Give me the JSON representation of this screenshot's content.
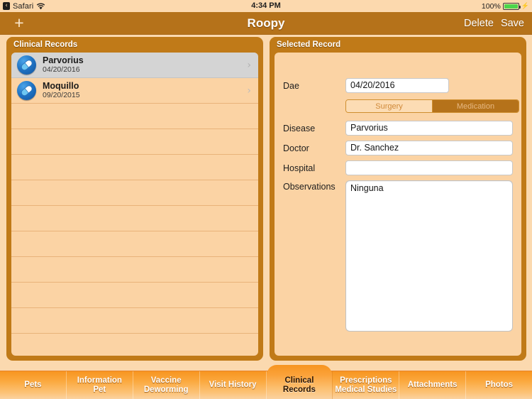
{
  "status_bar": {
    "back_glyph": "‹",
    "back_app": "Safari",
    "wifi_icon": "wifi-icon",
    "time": "4:34 PM",
    "battery_percent": "100%",
    "battery_icon": "battery-full-charging-icon"
  },
  "nav_bar": {
    "add_icon": "plus-icon",
    "add_label": "+",
    "title": "Roopy",
    "delete_label": "Delete",
    "save_label": "Save"
  },
  "left_panel": {
    "header": "Clinical Records",
    "records": [
      {
        "icon": "pill-icon",
        "title": "Parvorius",
        "date": "04/20/2016",
        "selected": true,
        "chevron": "›"
      },
      {
        "icon": "pill-icon",
        "title": "Moquillo",
        "date": "09/20/2015",
        "selected": false,
        "chevron": "›"
      }
    ],
    "empty_row_count": 10
  },
  "right_panel": {
    "header": "Selected Record",
    "fields": {
      "date_label": "Dae",
      "date_value": "04/20/2016",
      "disease_label": "Disease",
      "disease_value": "Parvorius",
      "doctor_label": "Doctor",
      "doctor_value": "Dr. Sanchez",
      "hospital_label": "Hospital",
      "hospital_value": "",
      "observations_label": "Observations",
      "observations_value": "Ninguna"
    },
    "segmented": {
      "options": [
        "Surgery",
        "Medication"
      ],
      "surgery_label": "Surgery",
      "medication_label": "Medication",
      "selected": "Medication"
    }
  },
  "tab_bar": {
    "active": "Clinical Records",
    "tabs": [
      {
        "line1": "Pets",
        "line2": ""
      },
      {
        "line1": "Information",
        "line2": "Pet"
      },
      {
        "line1": "Vaccine",
        "line2": "Deworming"
      },
      {
        "line1": "Visit History",
        "line2": ""
      },
      {
        "line1": "Clinical",
        "line2": "Records"
      },
      {
        "line1": "Prescriptions",
        "line2": "Medical Studies"
      },
      {
        "line1": "Attachments",
        "line2": ""
      },
      {
        "line1": "Photos",
        "line2": ""
      }
    ]
  },
  "colors": {
    "page_bg": "#fbd9af",
    "nav_bar": "#b5721a",
    "panel_frame": "#c07a18",
    "panel_body": "#fbd3a4",
    "tab_bar_top": "#f79520",
    "selected_row": "#d4d4d4",
    "battery_green": "#4cd54c",
    "icon_blue": "#1f73c4"
  }
}
